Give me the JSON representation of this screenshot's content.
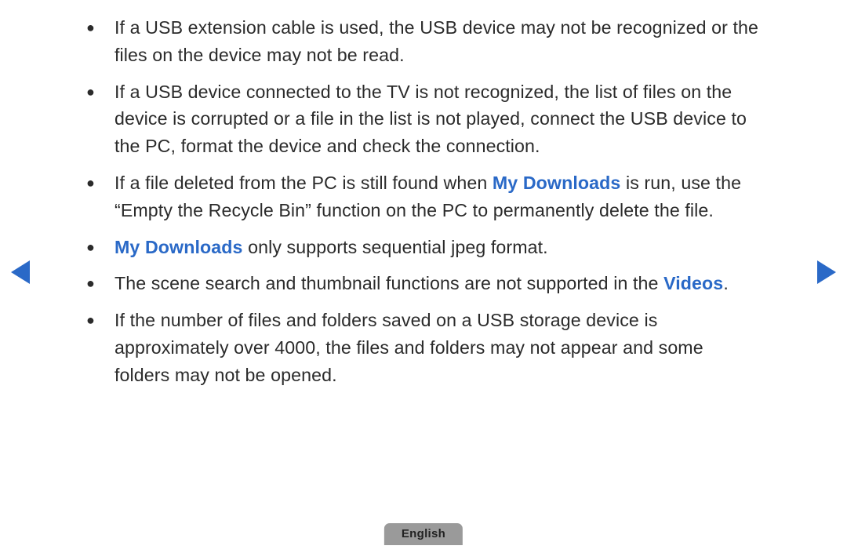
{
  "bullets": [
    {
      "segments": [
        {
          "text": "If a USB extension cable is used, the USB device may not be recognized or the files on the device may not be read."
        }
      ]
    },
    {
      "segments": [
        {
          "text": "If a USB device connected to the TV is not recognized, the list of files on the device is corrupted or a file in the list is not played, connect the USB device to the PC, format the device and check the connection."
        }
      ]
    },
    {
      "segments": [
        {
          "text": "If a file deleted from the PC is still found when "
        },
        {
          "text": "My Downloads",
          "hl": true
        },
        {
          "text": " is run, use the “Empty the Recycle Bin” function on the PC to permanently delete the file."
        }
      ]
    },
    {
      "segments": [
        {
          "text": "My Downloads",
          "hl": true
        },
        {
          "text": " only supports sequential jpeg format."
        }
      ]
    },
    {
      "segments": [
        {
          "text": "The scene search and thumbnail functions are not supported in the "
        },
        {
          "text": "Videos",
          "hl": true
        },
        {
          "text": "."
        }
      ]
    },
    {
      "segments": [
        {
          "text": "If the number of files and folders saved on a USB storage device is approximately over 4000, the files and folders may not appear and some folders may not be opened."
        }
      ]
    }
  ],
  "language_label": "English"
}
